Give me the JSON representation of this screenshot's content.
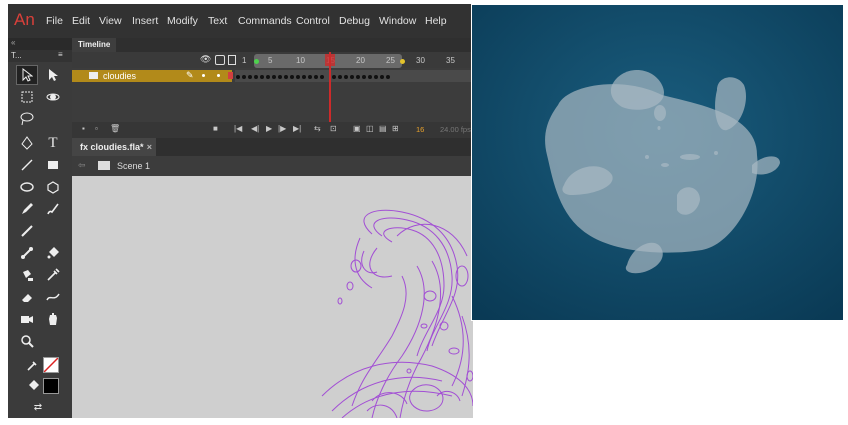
{
  "app": {
    "logo": "An",
    "menu": [
      "File",
      "Edit",
      "View",
      "Insert",
      "Modify",
      "Text",
      "Commands",
      "Control",
      "Debug",
      "Window",
      "Help"
    ]
  },
  "tools_panel": {
    "collapse": "«",
    "title": "T...",
    "menu_icon": "≡"
  },
  "timeline": {
    "tab": "Timeline",
    "frame_numbers": [
      "1",
      "5",
      "10",
      "15",
      "20",
      "25",
      "30",
      "35"
    ],
    "layers": [
      {
        "name": "cloudies",
        "selected": true
      }
    ],
    "current_frame": "16",
    "fps": "24.00 fps"
  },
  "document": {
    "tab": "fx cloudies.fla*",
    "close": "×",
    "scene": "Scene 1"
  },
  "preview": {
    "background": "#0f4a68",
    "blob_color": "#aab9c3"
  },
  "colors": {
    "layer_highlight": "#b28a1a",
    "playhead": "#cc2a2a",
    "stroke_lines": "#a24fd4",
    "stage": "#cfcfcf"
  }
}
